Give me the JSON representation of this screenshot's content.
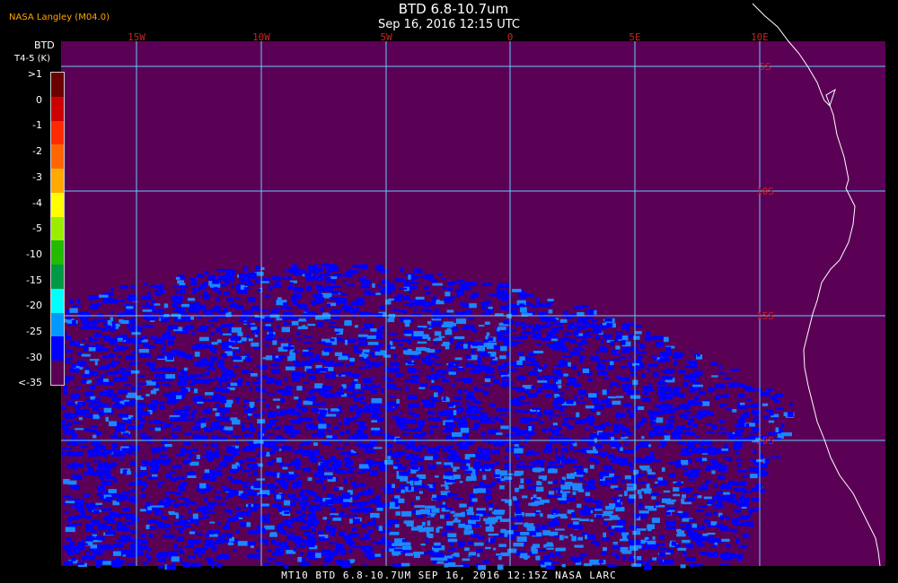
{
  "header": {
    "agency": "NASA Langley (M04.0)",
    "title": "BTD 6.8-10.7um",
    "subtitle": "Sep 16, 2016 12:15 UTC"
  },
  "colorbar": {
    "title": "BTD",
    "subtitle": "T4-5 (K)",
    "labels": [
      ">1",
      "0",
      "-1",
      "-2",
      "-3",
      "-4",
      "-5",
      "-10",
      "-15",
      "-20",
      "-25",
      "-30",
      "<-35"
    ],
    "colors": [
      "#6b0000",
      "#cc0000",
      "#ff2a00",
      "#ff6600",
      "#ffaa00",
      "#ffff00",
      "#99ee00",
      "#22bb00",
      "#009944",
      "#00ffff",
      "#0099ff",
      "#0000ff",
      "#5a0055"
    ]
  },
  "map": {
    "background_color": "#5a0055",
    "grid_color": "#66ccff",
    "coast_color": "#ffffff",
    "lon_labels": [
      "15W",
      "10W",
      "5W",
      "0",
      "5E",
      "10E"
    ],
    "lat_labels": [
      "5S",
      "10S",
      "15S",
      "20S"
    ],
    "label_color": "#cc2222"
  },
  "footer": {
    "text": "MT10  BTD 6.8-10.7UM   SEP 16, 2016 12:15Z  NASA LARC"
  }
}
